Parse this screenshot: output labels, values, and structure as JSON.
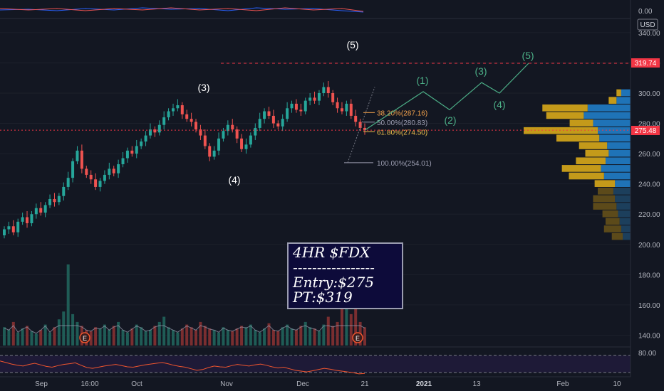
{
  "app": {
    "symbol": "FDX",
    "timeframe": "4HR",
    "currency": "USD"
  },
  "note": {
    "line1": "4HR $FDX",
    "line2": "-----------------",
    "line3": "Entry:$275",
    "line4": "PT:$319"
  },
  "price_axis": {
    "ticks": [
      340,
      320,
      300,
      280,
      260,
      240,
      220,
      200,
      180,
      160,
      140
    ],
    "tick_labels": [
      "340.00",
      "320.00",
      "300.00",
      "280.00",
      "260.00",
      "240.00",
      "220.00",
      "200.00",
      "180.00",
      "160.00",
      "140.00"
    ],
    "target_label": "319.74",
    "current_label": "275.48",
    "top_panel_label": "0.00",
    "rsi_label": "80.00",
    "colors": {
      "target": "#f23645",
      "current": "#f23645",
      "text": "#b2b5be"
    }
  },
  "time_axis": {
    "labels": [
      "Sep",
      "16:00",
      "Oct",
      "Nov",
      "Dec",
      "21",
      "2021",
      "13",
      "Feb",
      "10"
    ]
  },
  "fibonacci": [
    {
      "label": "38.20%(287.16)",
      "price": 287.16,
      "color": "#f0a04b"
    },
    {
      "label": "50.00%(280.83)",
      "price": 280.83,
      "color": "#9b9db0"
    },
    {
      "label": "61.80%(274.50)",
      "price": 274.5,
      "color": "#f0c24b"
    },
    {
      "label": "100.00%(254.01)",
      "price": 254.01,
      "color": "#9b9db0"
    }
  ],
  "waves_past": [
    {
      "label": "(3)",
      "color": "#ffffff"
    },
    {
      "label": "(4)",
      "color": "#ffffff"
    },
    {
      "label": "(5)",
      "color": "#ffffff"
    }
  ],
  "waves_projected": {
    "labels": [
      "(1)",
      "(2)",
      "(3)",
      "(4)",
      "(5)"
    ],
    "prices": [
      301,
      289,
      307,
      300,
      319.74
    ],
    "color": "#4caf87"
  },
  "earnings_markers": [
    "E",
    "E"
  ],
  "chart_data": {
    "type": "candlestick",
    "title": "",
    "y_range": [
      200,
      345
    ],
    "candles_close": [
      210,
      212,
      208,
      215,
      218,
      214,
      220,
      224,
      221,
      226,
      230,
      228,
      232,
      238,
      244,
      255,
      262,
      250,
      246,
      243,
      238,
      242,
      246,
      250,
      247,
      253,
      257,
      262,
      260,
      265,
      268,
      272,
      276,
      274,
      279,
      284,
      288,
      290,
      292,
      286,
      283,
      281,
      276,
      272,
      265,
      258,
      262,
      270,
      275,
      279,
      276,
      270,
      263,
      266,
      272,
      277,
      283,
      288,
      285,
      280,
      278,
      283,
      290,
      293,
      289,
      288,
      295,
      297,
      295,
      300,
      304,
      300,
      294,
      290,
      288,
      293,
      285,
      281,
      277,
      275.48
    ],
    "volume_profile": {
      "price_bins": [
        300,
        295,
        290,
        285,
        280,
        275,
        270,
        265,
        260,
        255,
        250,
        245,
        240,
        235,
        230,
        225,
        220,
        215,
        210,
        205
      ],
      "up_volume": [
        12,
        18,
        55,
        60,
        48,
        42,
        40,
        30,
        28,
        32,
        38,
        34,
        20,
        22,
        20,
        18,
        16,
        14,
        12,
        10
      ],
      "down_volume": [
        6,
        10,
        58,
        48,
        30,
        95,
        55,
        36,
        30,
        38,
        50,
        45,
        26,
        20,
        28,
        30,
        20,
        18,
        22,
        14
      ]
    },
    "volume": [
      14,
      12,
      18,
      10,
      13,
      15,
      11,
      9,
      12,
      16,
      10,
      14,
      20,
      26,
      62,
      24,
      18,
      15,
      12,
      11,
      14,
      13,
      16,
      12,
      15,
      18,
      12,
      10,
      13,
      16,
      14,
      11,
      12,
      15,
      18,
      22,
      14,
      12,
      10,
      13,
      16,
      14,
      12,
      18,
      15,
      13,
      12,
      10,
      14,
      12,
      11,
      13,
      15,
      14,
      16,
      12,
      10,
      13,
      17,
      12,
      11,
      14,
      16,
      13,
      12,
      15,
      18,
      14,
      13,
      11,
      16,
      22,
      15,
      18,
      50,
      36,
      24,
      40,
      18,
      14
    ],
    "rsi": [
      66,
      62,
      58,
      55,
      53,
      57,
      60,
      56,
      52,
      50,
      54,
      57,
      59,
      61,
      55,
      49,
      47,
      50,
      53,
      55,
      57,
      54,
      51,
      50,
      53,
      56,
      58,
      60,
      62,
      59,
      55,
      52,
      50,
      46,
      42,
      44,
      49,
      53,
      51,
      50,
      54,
      57,
      55,
      53,
      56,
      58,
      55,
      51,
      48,
      50,
      46,
      42,
      40,
      38,
      41,
      44,
      47,
      45,
      42,
      40,
      38,
      36,
      33,
      34
    ]
  }
}
